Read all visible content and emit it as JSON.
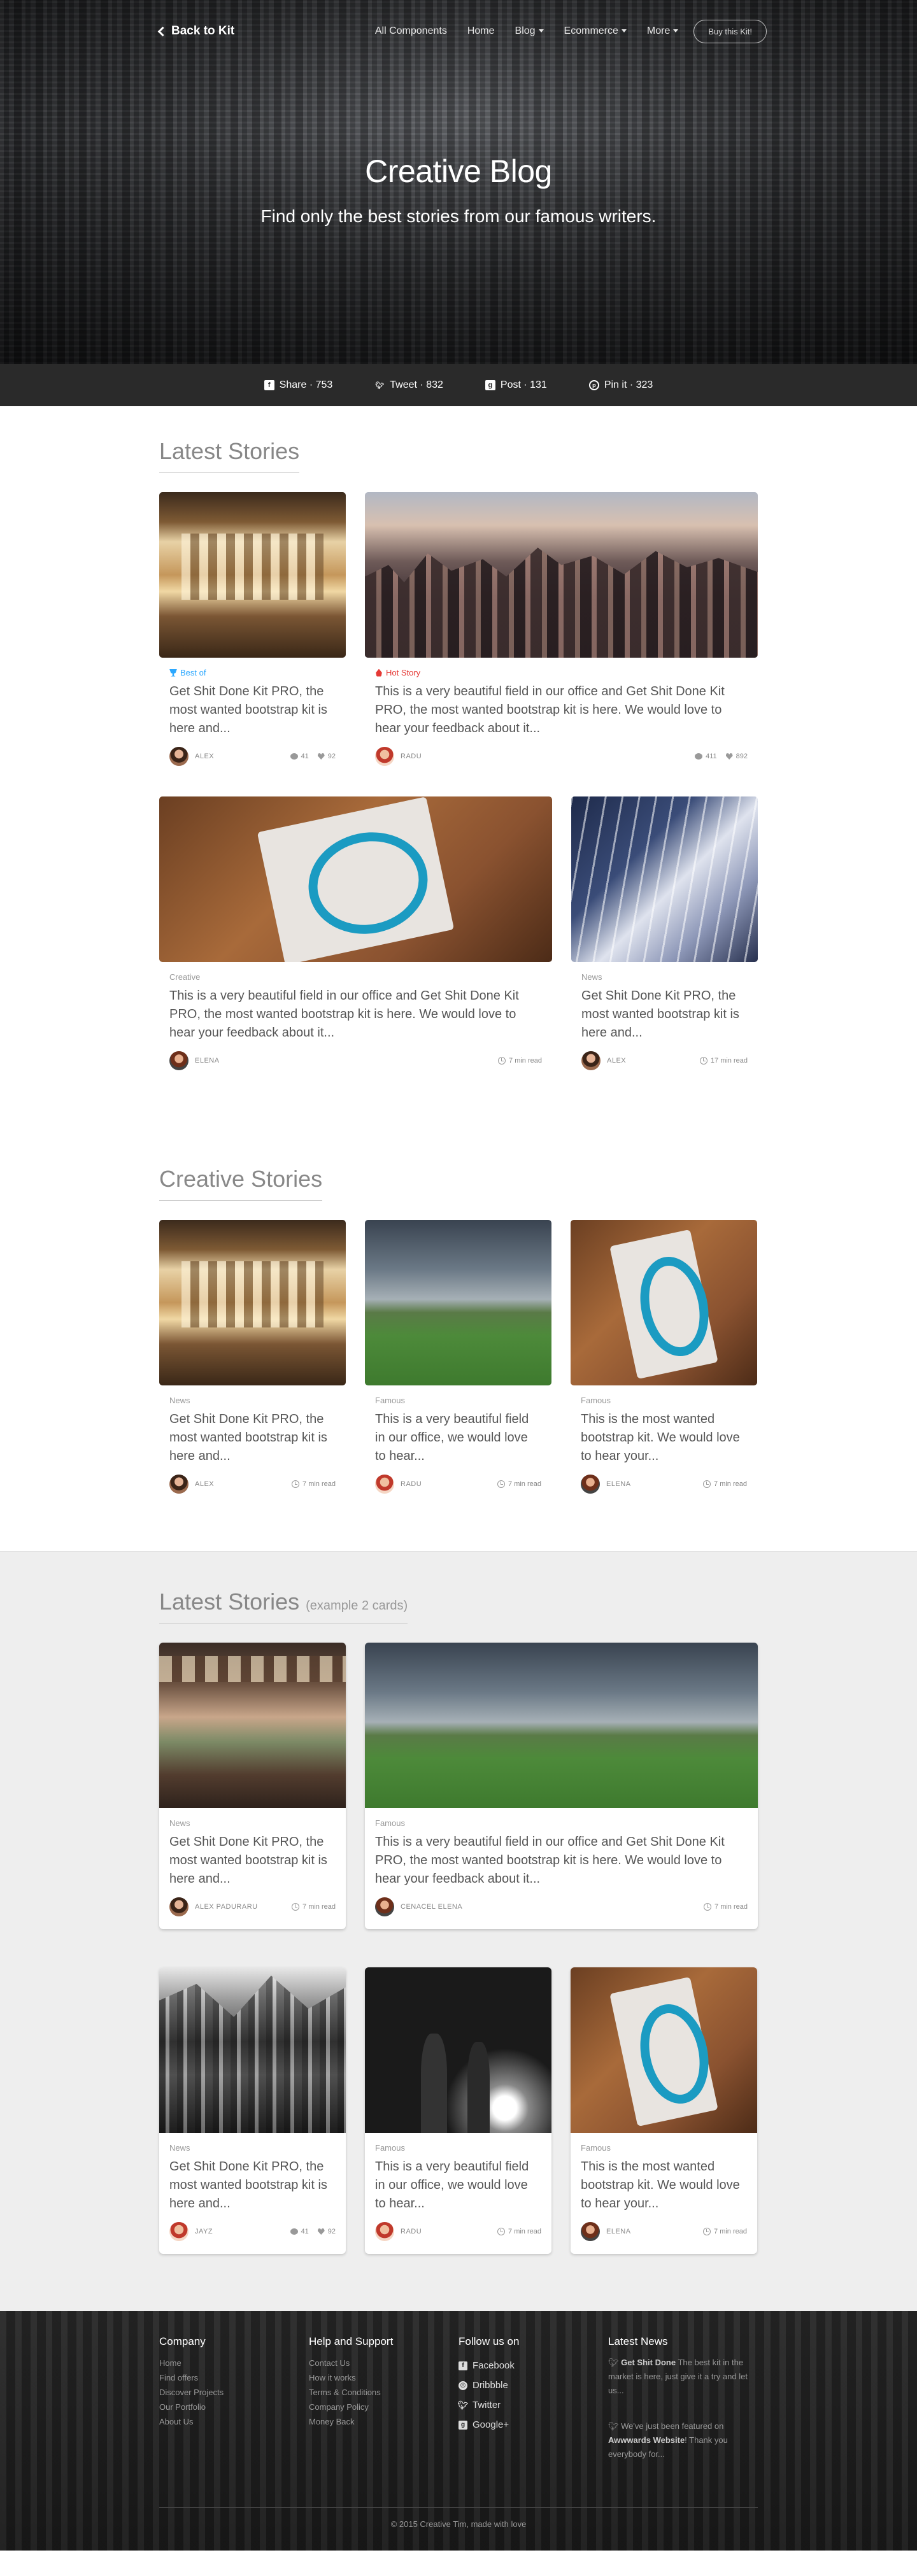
{
  "nav": {
    "back_label": "Back to Kit",
    "links": [
      "All Components",
      "Home",
      "Blog",
      "Ecommerce",
      "More"
    ],
    "buy_label": "Buy this Kit!"
  },
  "hero": {
    "title": "Creative Blog",
    "subtitle": "Find only the best stories from our famous writers."
  },
  "share": {
    "facebook": "Share · 753",
    "twitter": "Tweet · 832",
    "google": "Post · 131",
    "pinterest": "Pin it · 323"
  },
  "latest": {
    "title": "Latest Stories",
    "cards": [
      {
        "category": "Best of",
        "title": "Get Shit Done Kit PRO, the most wanted bootstrap kit is here and...",
        "author": "Alex",
        "comments": "41",
        "likes": "92"
      },
      {
        "category": "Hot Story",
        "title": "This is a very beautiful field in our office and Get Shit Done Kit PRO, the most wanted bootstrap kit is here. We would love to hear your feedback about it...",
        "author": "Radu",
        "comments": "411",
        "likes": "892"
      },
      {
        "category": "Creative",
        "title": "This is a very beautiful field in our office and Get Shit Done Kit PRO, the most wanted bootstrap kit is here. We would love to hear your feedback about it...",
        "author": "Elena",
        "read": "7 min read"
      },
      {
        "category": "News",
        "title": "Get Shit Done Kit PRO, the most wanted bootstrap kit is here and...",
        "author": "Alex",
        "read": "17 min read"
      }
    ]
  },
  "creative": {
    "title": "Creative Stories",
    "cards": [
      {
        "category": "News",
        "title": "Get Shit Done Kit PRO, the most wanted bootstrap kit is here and...",
        "author": "Alex",
        "read": "7 min read"
      },
      {
        "category": "Famous",
        "title": "This is a very beautiful field in our office, we would love to hear...",
        "author": "Radu",
        "read": "7 min read"
      },
      {
        "category": "Famous",
        "title": "This is the most wanted bootstrap kit. We would love to hear your...",
        "author": "Elena",
        "read": "7 min read"
      }
    ]
  },
  "latest2": {
    "title": "Latest Stories",
    "title_small": "(example 2 cards)",
    "cards": [
      {
        "category": "News",
        "title": "Get Shit Done Kit PRO, the most wanted bootstrap kit is here and...",
        "author": "Alex Paduraru",
        "read": "7 min read"
      },
      {
        "category": "Famous",
        "title": "This is a very beautiful field in our office and Get Shit Done Kit PRO, the most wanted bootstrap kit is here. We would love to hear your feedback about it...",
        "author": "Cenacel Elena",
        "read": "7 min read"
      },
      {
        "category": "News",
        "title": "Get Shit Done Kit PRO, the most wanted bootstrap kit is here and...",
        "author": "Jayz",
        "comments": "41",
        "likes": "92"
      },
      {
        "category": "Famous",
        "title": "This is a very beautiful field in our office, we would love to hear...",
        "author": "Radu",
        "read": "7 min read"
      },
      {
        "category": "Famous",
        "title": "This is the most wanted bootstrap kit. We would love to hear your...",
        "author": "Elena",
        "read": "7 min read"
      }
    ]
  },
  "footer": {
    "company": {
      "title": "Company",
      "links": [
        "Home",
        "Find offers",
        "Discover Projects",
        "Our Portfolio",
        "About Us"
      ]
    },
    "help": {
      "title": "Help and Support",
      "links": [
        "Contact Us",
        "How it works",
        "Terms & Conditions",
        "Company Policy",
        "Money Back"
      ]
    },
    "follow": {
      "title": "Follow us on",
      "links": [
        "Facebook",
        "Dribbble",
        "Twitter",
        "Google+"
      ]
    },
    "news": {
      "title": "Latest News",
      "items": [
        {
          "bold": "Get Shit Done",
          "text": " The best kit in the market is here, just give it a try and let us..."
        },
        {
          "pre": "We've just been featured on ",
          "bold": "Awwwards Website",
          "text": "! Thank you everybody for..."
        }
      ]
    },
    "copyright": "© 2015 Creative Tim, made with love"
  }
}
